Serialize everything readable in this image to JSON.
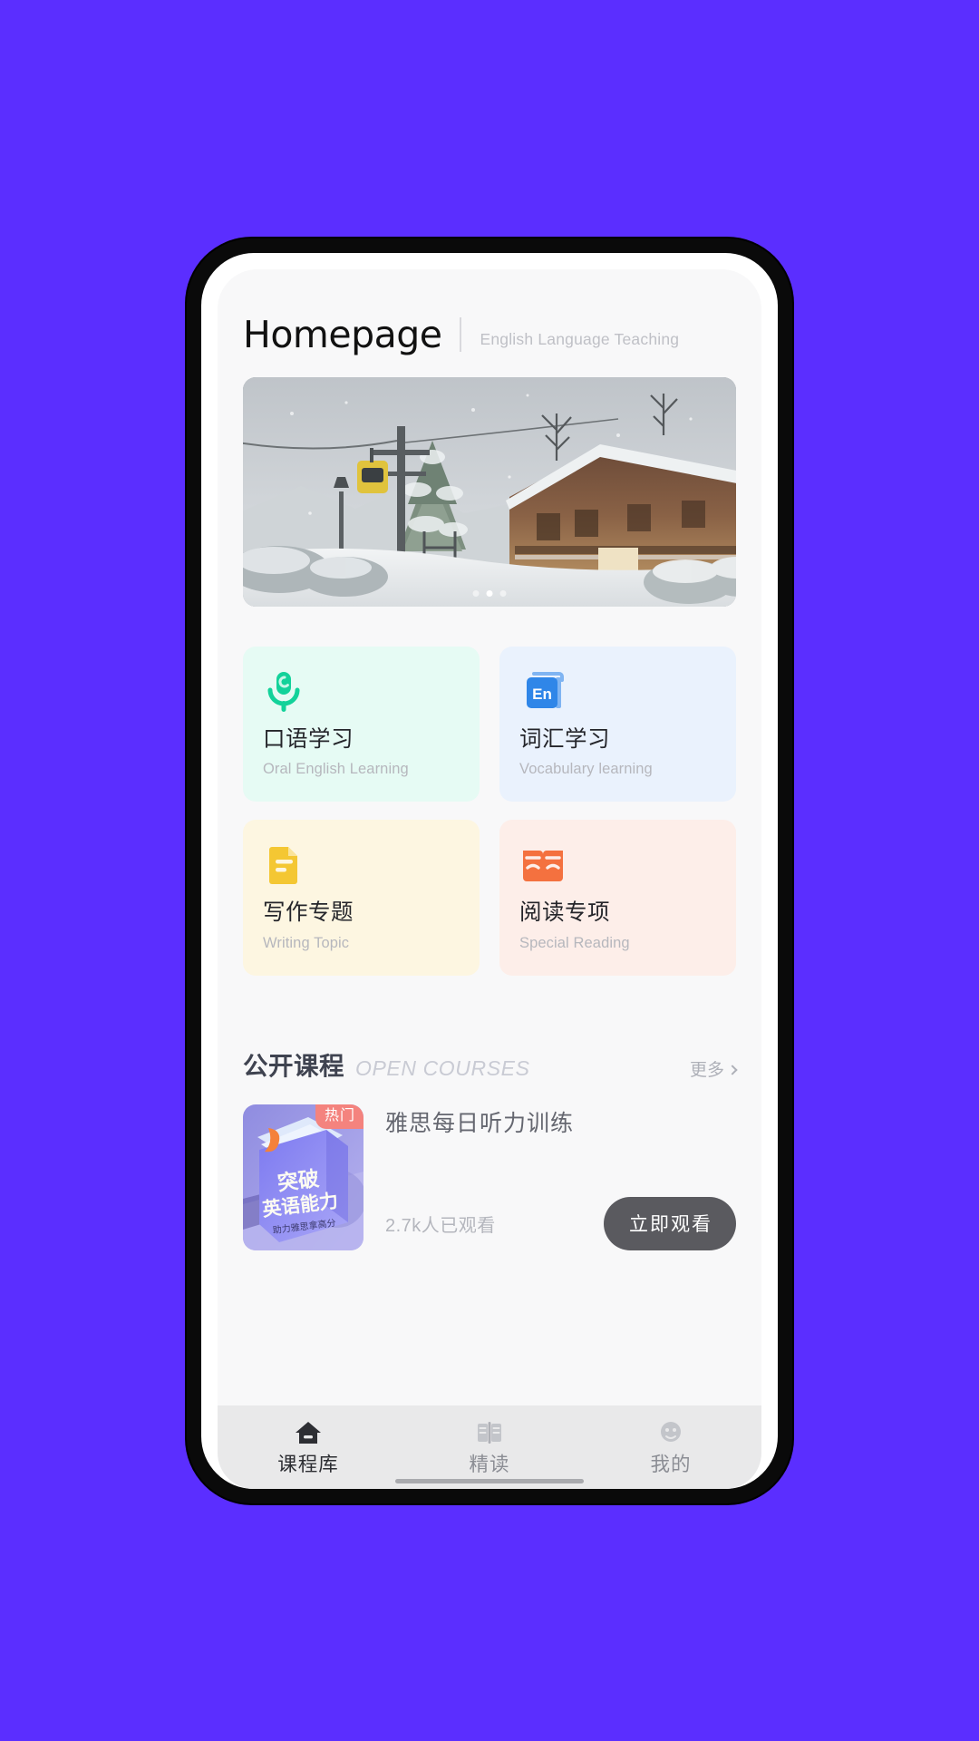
{
  "header": {
    "title": "Homepage",
    "subtitle": "English Language Teaching"
  },
  "banner": {
    "name": "snowy-chalet-ski-resort-photo",
    "dots": 3,
    "active_dot": 2
  },
  "categories": [
    {
      "title": "口语学习",
      "subtitle": "Oral English Learning",
      "icon": "microphone-icon",
      "bg": "#e6fbf4",
      "accent": "#13d29a"
    },
    {
      "title": "词汇学习",
      "subtitle": "Vocabulary learning",
      "icon": "en-book-icon",
      "bg": "#eaf2fd",
      "accent": "#2f86e8",
      "icon_text": "En"
    },
    {
      "title": "写作专题",
      "subtitle": "Writing Topic",
      "icon": "document-icon",
      "bg": "#fdf6e1",
      "accent": "#f4c733"
    },
    {
      "title": "阅读专项",
      "subtitle": "Special Reading",
      "icon": "open-book-icon",
      "bg": "#fdeee9",
      "accent": "#f4713f"
    }
  ],
  "open_courses": {
    "title_cn": "公开课程",
    "title_en": "OPEN COURSES",
    "more_label": "更多",
    "course": {
      "badge": "热门",
      "title": "雅思每日听力训练",
      "views": "2.7k人已观看",
      "cta": "立即观看",
      "thumb_line1": "突破",
      "thumb_line2": "英语能力",
      "thumb_line3": "助力雅思拿高分"
    }
  },
  "tabbar": {
    "items": [
      {
        "label": "课程库",
        "icon": "home-icon",
        "active": true
      },
      {
        "label": "精读",
        "icon": "book-pages-icon",
        "active": false
      },
      {
        "label": "我的",
        "icon": "user-profile-icon",
        "active": false
      }
    ]
  },
  "colors": {
    "page_background": "#5B2EFF",
    "screen_background": "#f8f8f9",
    "tabbar_background": "#e9e9ea",
    "cta_button": "#5a5a5f",
    "badge": "#f4837e"
  }
}
